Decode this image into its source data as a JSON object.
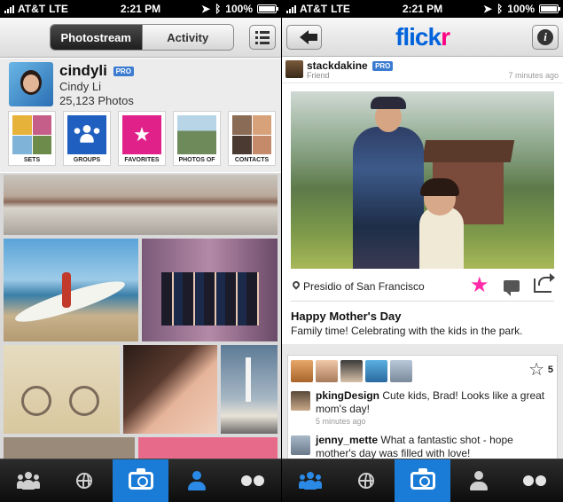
{
  "left": {
    "status": {
      "carrier": "AT&T",
      "network": "LTE",
      "time": "2:21 PM",
      "battery": "100%"
    },
    "nav": {
      "tab_photostream": "Photostream",
      "tab_activity": "Activity"
    },
    "profile": {
      "username": "cindyli",
      "pro_badge": "PRO",
      "realname": "Cindy Li",
      "photo_count": "25,123 Photos"
    },
    "tiles": [
      {
        "label": "SETS"
      },
      {
        "label": "GROUPS"
      },
      {
        "label": "FAVORITES"
      },
      {
        "label": "PHOTOS OF"
      },
      {
        "label": "CONTACTS"
      }
    ],
    "tabbar": [
      "contacts-icon",
      "globe-icon",
      "camera-icon",
      "profile-icon",
      "flickr-dots-icon"
    ]
  },
  "right": {
    "status": {
      "carrier": "AT&T",
      "network": "LTE",
      "time": "2:21 PM",
      "battery": "100%"
    },
    "nav": {
      "logo_part1": "flick",
      "logo_part2": "r"
    },
    "post": {
      "username": "stackdakine",
      "pro_badge": "PRO",
      "relation": "Friend",
      "time_ago": "7 minutes ago",
      "location": "Presidio of San Francisco",
      "title": "Happy Mother's Day",
      "description": "Family time! Celebrating with the kids in the park."
    },
    "favorites_count": "5",
    "comments": [
      {
        "user": "pkingDesign",
        "text": "Cute kids, Brad! Looks like a great mom's day!",
        "time": "5 minutes ago"
      },
      {
        "user": "jenny_mette",
        "text": "What a fantastic shot - hope mother's day was filled with love!",
        "time": ""
      }
    ],
    "tabbar": [
      "contacts-icon",
      "globe-icon",
      "camera-icon",
      "profile-icon",
      "flickr-dots-icon"
    ]
  },
  "colors": {
    "flickr_blue": "#0063dc",
    "flickr_pink": "#ff0084",
    "tab_active": "#1a7cd6"
  }
}
